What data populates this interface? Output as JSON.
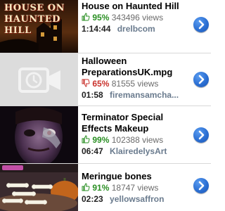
{
  "videos": [
    {
      "title": "House on Haunted Hill",
      "thumb_text": "HOUSE ON HAUNTED HILL",
      "rating_icon": "thumbs-up-icon",
      "rating": "95%",
      "views": "343496 views",
      "duration": "1:14:44",
      "uploader": "drelbcom"
    },
    {
      "title": "Halloween PreparationsUK.mpg",
      "rating_icon": "thumbs-down-icon",
      "rating": "65%",
      "views": "81555 views",
      "duration": "01:58",
      "uploader": "firemansamcha..."
    },
    {
      "title": "Terminator Special Effects Makeup",
      "rating_icon": "thumbs-up-icon",
      "rating": "99%",
      "views": "102388 views",
      "duration": "06:47",
      "uploader": "KlairedelysArt"
    },
    {
      "title": "Meringue bones",
      "rating_icon": "thumbs-up-icon",
      "rating": "91%",
      "views": "18747 views",
      "duration": "02:23",
      "uploader": "yellowsaffron"
    }
  ],
  "colors": {
    "rating_good": "#2a8f23",
    "rating_bad": "#c9322c",
    "uploader": "#6a7b8e",
    "disclosure_button": "#2b6fd3"
  }
}
